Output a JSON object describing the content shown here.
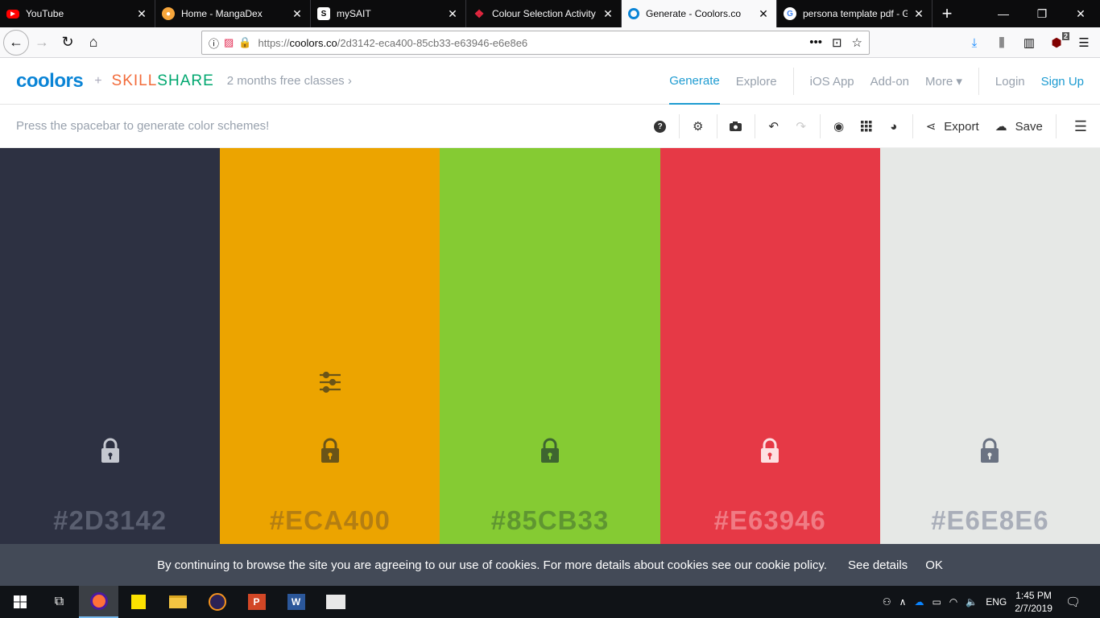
{
  "browser": {
    "tabs": [
      {
        "label": "YouTube",
        "icon": "youtube-icon",
        "color": "#ff0000"
      },
      {
        "label": "Home - MangaDex",
        "icon": "mangadex-icon",
        "color": "#f7a63b"
      },
      {
        "label": "mySAIT",
        "icon": "sait-icon",
        "color": "#ffffff"
      },
      {
        "label": "Colour Selection Activity",
        "icon": "d2l-icon",
        "color": "#e0263e"
      },
      {
        "label": "Generate - Coolors.co",
        "icon": "coolors-icon",
        "color": "#0a84d6",
        "active": true
      },
      {
        "label": "persona template pdf - G",
        "icon": "google-icon",
        "color": "#4285f4"
      }
    ],
    "url_prefix": "https://",
    "url_host": "coolors.co",
    "url_path": "/2d3142-eca400-85cb33-e63946-e6e8e6",
    "url_menu": "•••",
    "new_tab": "+",
    "addon_badge": "2"
  },
  "site": {
    "logo": "coolors",
    "plus": "+",
    "skillshare_a": "SKILL",
    "skillshare_b": "SHARE",
    "promo": "2 months free classes",
    "promo_arrow": "›",
    "nav": {
      "generate": "Generate",
      "explore": "Explore",
      "ios": "iOS App",
      "addon": "Add-on",
      "more": "More",
      "more_arrow": "▾",
      "login": "Login",
      "signup": "Sign Up"
    }
  },
  "toolbar": {
    "hint": "Press the spacebar to generate color schemes!",
    "export": "Export",
    "save": "Save"
  },
  "palette": [
    {
      "hex": "#2D3142",
      "bg": "#2d3142",
      "fg": "#5a5f70",
      "icon": "#c5c8d0"
    },
    {
      "hex": "#ECA400",
      "bg": "#eca400",
      "fg": "#b47e12",
      "icon": "#6a5418"
    },
    {
      "hex": "#85CB33",
      "bg": "#85cb33",
      "fg": "#5f9631",
      "icon": "#3e6530"
    },
    {
      "hex": "#E63946",
      "bg": "#e63946",
      "fg": "#f07b84",
      "icon": "#fde0e2"
    },
    {
      "hex": "#E6E8E6",
      "bg": "#e6e8e6",
      "fg": "#a9aeb9",
      "icon": "#6a7282"
    }
  ],
  "cookie": {
    "message": "By continuing to browse the site you are agreeing to our use of cookies. For more details about cookies see our cookie policy.",
    "details": "See details",
    "ok": "OK"
  },
  "taskbar": {
    "time": "1:45 PM",
    "date": "2/7/2019",
    "lang": "ENG"
  }
}
